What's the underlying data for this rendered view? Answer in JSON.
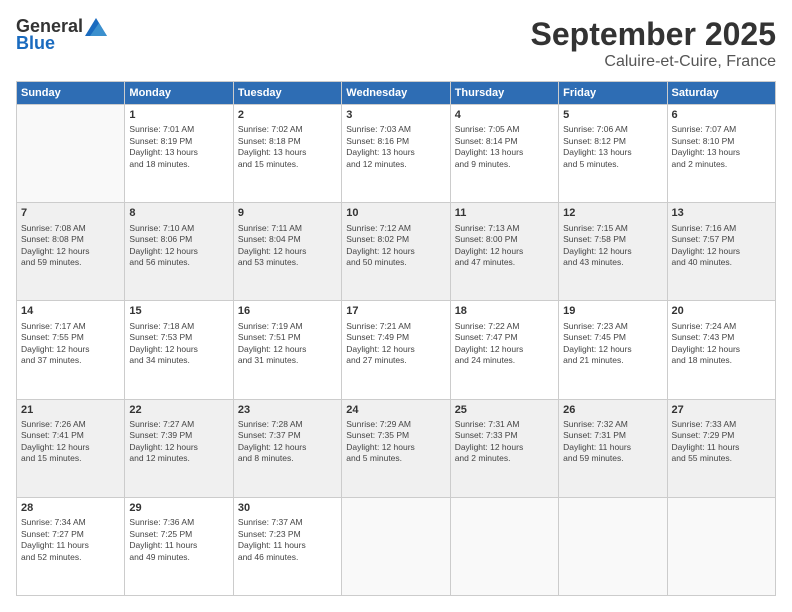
{
  "header": {
    "logo_general": "General",
    "logo_blue": "Blue",
    "month": "September 2025",
    "location": "Caluire-et-Cuire, France"
  },
  "days_of_week": [
    "Sunday",
    "Monday",
    "Tuesday",
    "Wednesday",
    "Thursday",
    "Friday",
    "Saturday"
  ],
  "weeks": [
    [
      {
        "day": "",
        "info": ""
      },
      {
        "day": "1",
        "info": "Sunrise: 7:01 AM\nSunset: 8:19 PM\nDaylight: 13 hours\nand 18 minutes."
      },
      {
        "day": "2",
        "info": "Sunrise: 7:02 AM\nSunset: 8:18 PM\nDaylight: 13 hours\nand 15 minutes."
      },
      {
        "day": "3",
        "info": "Sunrise: 7:03 AM\nSunset: 8:16 PM\nDaylight: 13 hours\nand 12 minutes."
      },
      {
        "day": "4",
        "info": "Sunrise: 7:05 AM\nSunset: 8:14 PM\nDaylight: 13 hours\nand 9 minutes."
      },
      {
        "day": "5",
        "info": "Sunrise: 7:06 AM\nSunset: 8:12 PM\nDaylight: 13 hours\nand 5 minutes."
      },
      {
        "day": "6",
        "info": "Sunrise: 7:07 AM\nSunset: 8:10 PM\nDaylight: 13 hours\nand 2 minutes."
      }
    ],
    [
      {
        "day": "7",
        "info": "Sunrise: 7:08 AM\nSunset: 8:08 PM\nDaylight: 12 hours\nand 59 minutes."
      },
      {
        "day": "8",
        "info": "Sunrise: 7:10 AM\nSunset: 8:06 PM\nDaylight: 12 hours\nand 56 minutes."
      },
      {
        "day": "9",
        "info": "Sunrise: 7:11 AM\nSunset: 8:04 PM\nDaylight: 12 hours\nand 53 minutes."
      },
      {
        "day": "10",
        "info": "Sunrise: 7:12 AM\nSunset: 8:02 PM\nDaylight: 12 hours\nand 50 minutes."
      },
      {
        "day": "11",
        "info": "Sunrise: 7:13 AM\nSunset: 8:00 PM\nDaylight: 12 hours\nand 47 minutes."
      },
      {
        "day": "12",
        "info": "Sunrise: 7:15 AM\nSunset: 7:58 PM\nDaylight: 12 hours\nand 43 minutes."
      },
      {
        "day": "13",
        "info": "Sunrise: 7:16 AM\nSunset: 7:57 PM\nDaylight: 12 hours\nand 40 minutes."
      }
    ],
    [
      {
        "day": "14",
        "info": "Sunrise: 7:17 AM\nSunset: 7:55 PM\nDaylight: 12 hours\nand 37 minutes."
      },
      {
        "day": "15",
        "info": "Sunrise: 7:18 AM\nSunset: 7:53 PM\nDaylight: 12 hours\nand 34 minutes."
      },
      {
        "day": "16",
        "info": "Sunrise: 7:19 AM\nSunset: 7:51 PM\nDaylight: 12 hours\nand 31 minutes."
      },
      {
        "day": "17",
        "info": "Sunrise: 7:21 AM\nSunset: 7:49 PM\nDaylight: 12 hours\nand 27 minutes."
      },
      {
        "day": "18",
        "info": "Sunrise: 7:22 AM\nSunset: 7:47 PM\nDaylight: 12 hours\nand 24 minutes."
      },
      {
        "day": "19",
        "info": "Sunrise: 7:23 AM\nSunset: 7:45 PM\nDaylight: 12 hours\nand 21 minutes."
      },
      {
        "day": "20",
        "info": "Sunrise: 7:24 AM\nSunset: 7:43 PM\nDaylight: 12 hours\nand 18 minutes."
      }
    ],
    [
      {
        "day": "21",
        "info": "Sunrise: 7:26 AM\nSunset: 7:41 PM\nDaylight: 12 hours\nand 15 minutes."
      },
      {
        "day": "22",
        "info": "Sunrise: 7:27 AM\nSunset: 7:39 PM\nDaylight: 12 hours\nand 12 minutes."
      },
      {
        "day": "23",
        "info": "Sunrise: 7:28 AM\nSunset: 7:37 PM\nDaylight: 12 hours\nand 8 minutes."
      },
      {
        "day": "24",
        "info": "Sunrise: 7:29 AM\nSunset: 7:35 PM\nDaylight: 12 hours\nand 5 minutes."
      },
      {
        "day": "25",
        "info": "Sunrise: 7:31 AM\nSunset: 7:33 PM\nDaylight: 12 hours\nand 2 minutes."
      },
      {
        "day": "26",
        "info": "Sunrise: 7:32 AM\nSunset: 7:31 PM\nDaylight: 11 hours\nand 59 minutes."
      },
      {
        "day": "27",
        "info": "Sunrise: 7:33 AM\nSunset: 7:29 PM\nDaylight: 11 hours\nand 55 minutes."
      }
    ],
    [
      {
        "day": "28",
        "info": "Sunrise: 7:34 AM\nSunset: 7:27 PM\nDaylight: 11 hours\nand 52 minutes."
      },
      {
        "day": "29",
        "info": "Sunrise: 7:36 AM\nSunset: 7:25 PM\nDaylight: 11 hours\nand 49 minutes."
      },
      {
        "day": "30",
        "info": "Sunrise: 7:37 AM\nSunset: 7:23 PM\nDaylight: 11 hours\nand 46 minutes."
      },
      {
        "day": "",
        "info": ""
      },
      {
        "day": "",
        "info": ""
      },
      {
        "day": "",
        "info": ""
      },
      {
        "day": "",
        "info": ""
      }
    ]
  ]
}
